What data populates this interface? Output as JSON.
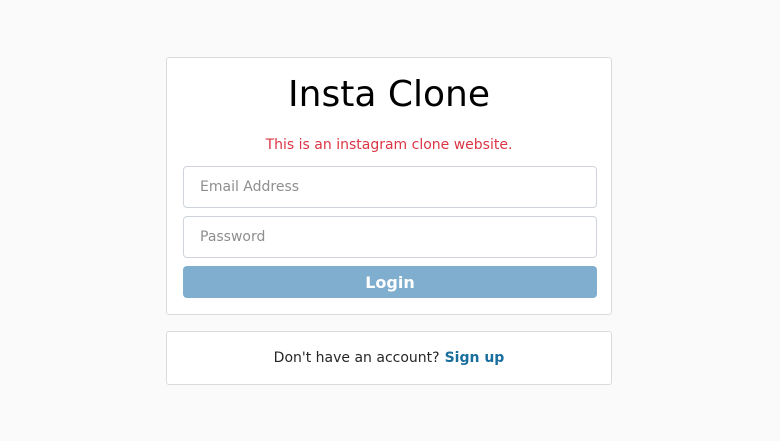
{
  "login": {
    "title": "Insta Clone",
    "subtitle": "This is an instagram clone website.",
    "email_placeholder": "Email Address",
    "password_placeholder": "Password",
    "login_label": "Login"
  },
  "signup": {
    "prompt": "Don't have an account?",
    "link_label": "Sign up"
  },
  "colors": {
    "subtitle": "#dc3545",
    "button": "#80aecf",
    "link": "#1a6e9e"
  }
}
